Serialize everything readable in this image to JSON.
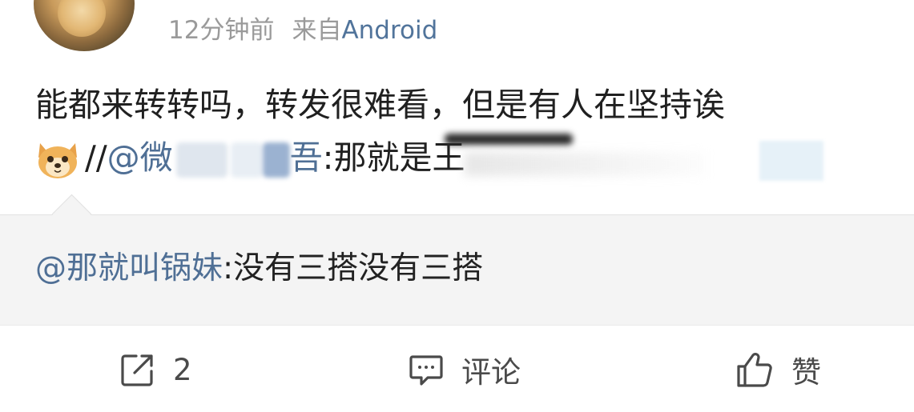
{
  "post": {
    "time_ago": "12分钟前",
    "source_prefix": "来自",
    "source_name": "Android",
    "text_line1": "能都来转转吗，转发很难看，但是有人在坚持诶",
    "repost_chain_prefix": "//",
    "repost_mention_visible": "@微",
    "repost_mention_tail": "吾",
    "repost_text_visible": ":那就是王"
  },
  "quoted": {
    "user": "@那就叫锅妹",
    "text": ":没有三搭没有三搭"
  },
  "actions": {
    "repost_count": "2",
    "comment_label": "评论",
    "like_label": "赞"
  },
  "colors": {
    "link": "#51749b",
    "meta_gray": "#9a9a9a",
    "quote_bg": "#f4f4f4"
  },
  "icons": {
    "repost": "share-arrow-icon",
    "comment": "comment-bubble-icon",
    "like": "thumbs-up-icon",
    "emoji": "doge-emoji-icon"
  }
}
